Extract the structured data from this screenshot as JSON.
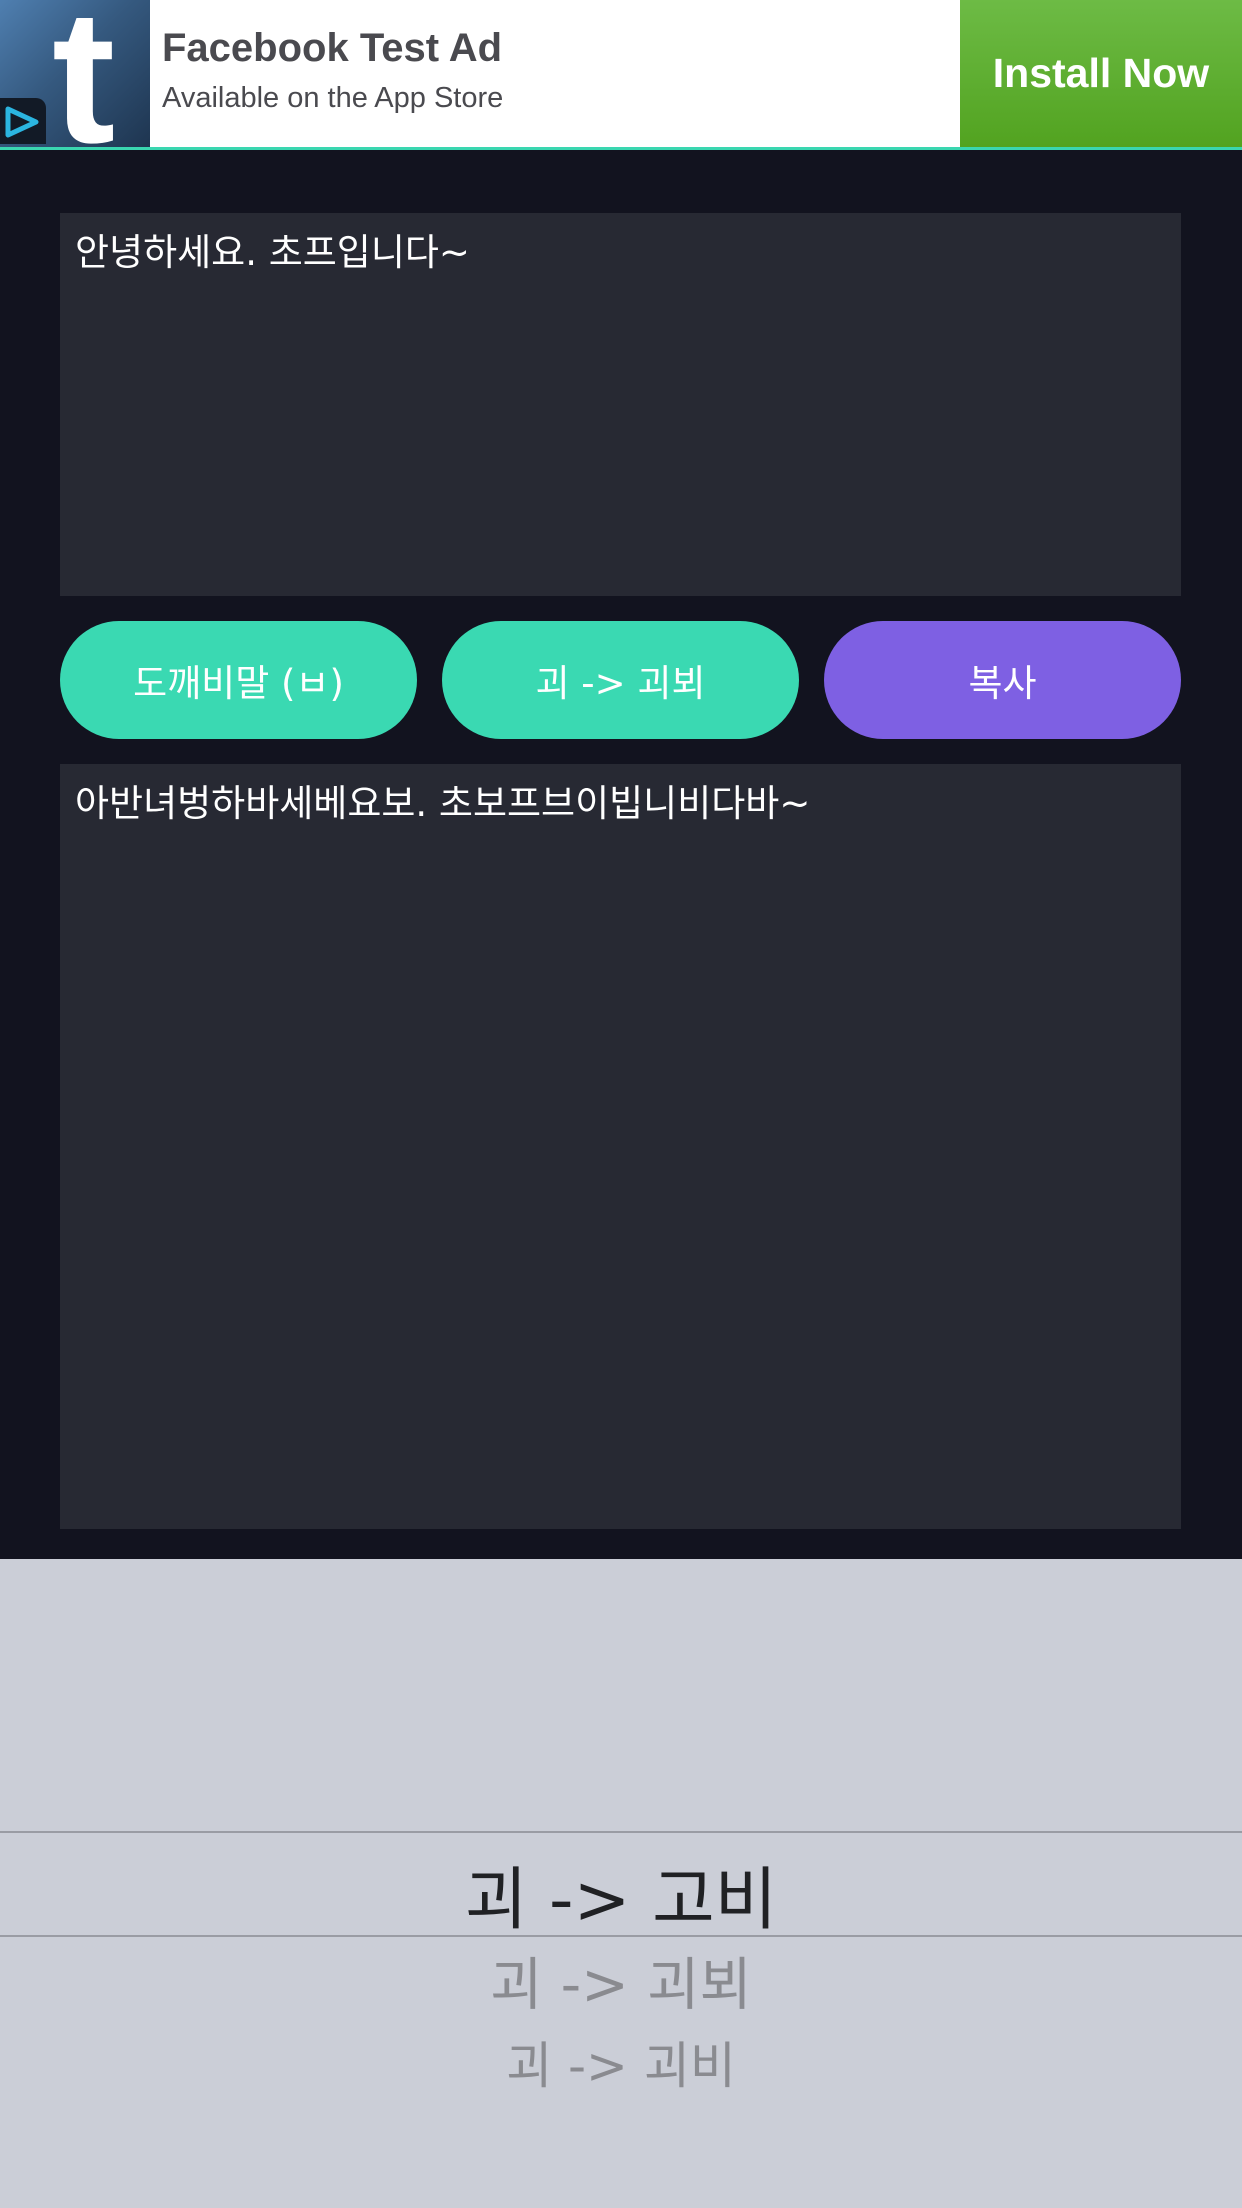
{
  "ad": {
    "title": "Facebook Test Ad",
    "subtitle": "Available on the App Store",
    "cta": "Install Now",
    "logo_letter": "t",
    "accent_color": "#3ad6b0",
    "cta_color": "#5aaa2c"
  },
  "input": {
    "text": "안녕하세요. 초프입니다~"
  },
  "buttons": {
    "dokkaebi_label": "도깨비말 (ㅂ)",
    "mode_label": "괴 -> 괴뵈",
    "copy_label": "복사",
    "teal_color": "#3ad9b2",
    "purple_color": "#7e60e3"
  },
  "output": {
    "text": "아반녀벙하바세베요보. 초보프브이빕니비다바~"
  },
  "picker": {
    "selected": "괴 -> 고비",
    "options": [
      "괴 -> 괴뵈",
      "괴 -> 괴비"
    ]
  }
}
